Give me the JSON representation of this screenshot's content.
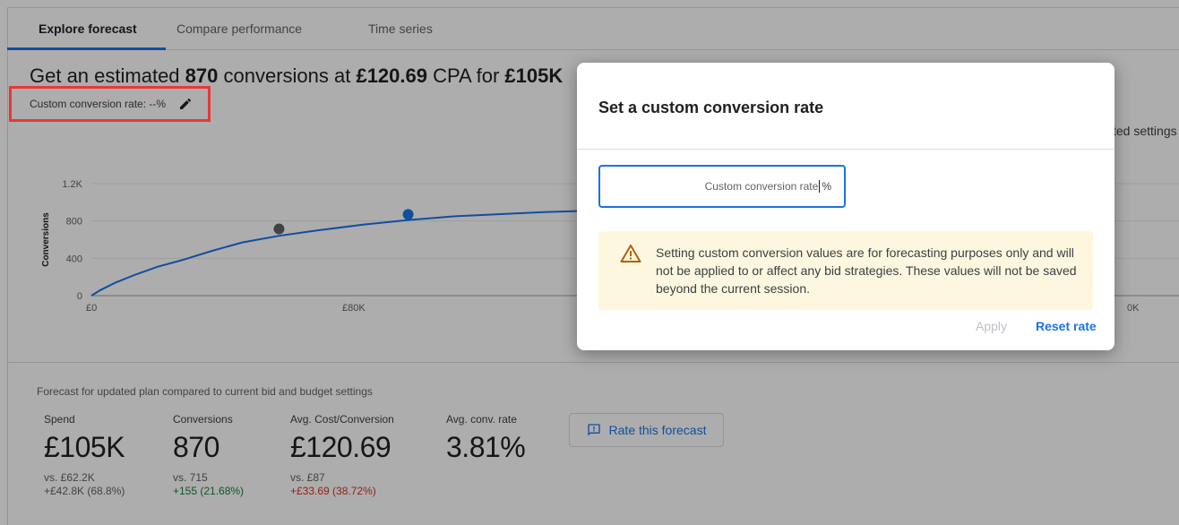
{
  "tabs": [
    {
      "label": "Explore forecast",
      "active": true
    },
    {
      "label": "Compare performance",
      "active": false
    },
    {
      "label": "Time series",
      "active": false
    }
  ],
  "headline": {
    "prefix": "Get an estimated ",
    "conversions": "870",
    "middle1": " conversions at ",
    "cpa": "£120.69",
    "middle2": " CPA for ",
    "budget": "£105K"
  },
  "custom_rate_label": "Custom conversion rate: --%",
  "right_fragment": "ted settings",
  "chart": {
    "ylabel": "Conversions",
    "y_ticks": [
      "1.2K",
      "800",
      "400",
      "0"
    ],
    "x_ticks": [
      "£0",
      "£80K",
      "0K"
    ]
  },
  "chart_data": {
    "type": "line",
    "ylabel": "Conversions",
    "xlabel": "",
    "ylim": [
      0,
      1200
    ],
    "y_tick_values": [
      0,
      400,
      800,
      1200
    ],
    "series": [
      {
        "x": [
          0,
          3,
          8,
          15,
          22,
          30,
          40,
          50,
          62,
          75,
          90,
          105,
          120,
          150,
          185,
          250,
          330
        ],
        "values": [
          0,
          60,
          140,
          230,
          310,
          380,
          480,
          570,
          640,
          700,
          760,
          810,
          850,
          895,
          930,
          1000,
          1070
        ]
      }
    ],
    "markers": [
      {
        "x": 62.2,
        "y": 715,
        "label": "current",
        "color": "#5f6368"
      },
      {
        "x": 105,
        "y": 870,
        "label": "forecast",
        "color": "#1a73e8"
      }
    ]
  },
  "forecast_note": "Forecast for updated plan compared to current bid and budget settings",
  "metrics": [
    {
      "label": "Spend",
      "value": "£105K",
      "vs": "vs. £62.2K",
      "delta": "+£42.8K (68.8%)",
      "delta_color": "#5f6368"
    },
    {
      "label": "Conversions",
      "value": "870",
      "vs": "vs. 715",
      "delta": "+155 (21.68%)",
      "delta_color": "#188038"
    },
    {
      "label": "Avg. Cost/Conversion",
      "value": "£120.69",
      "vs": "vs. £87",
      "delta": "+£33.69 (38.72%)",
      "delta_color": "#d93025"
    },
    {
      "label": "Avg. conv. rate",
      "value": "3.81%",
      "vs": "",
      "delta": "",
      "delta_color": "#5f6368"
    }
  ],
  "rate_forecast_label": "Rate this forecast",
  "dialog": {
    "title": "Set a custom conversion rate",
    "input_placeholder": "Custom conversion rate",
    "input_suffix": "%",
    "warning": "Setting custom conversion values are for forecasting purposes only and will not be applied to or affect any bid strategies. These values will not be saved beyond the current session.",
    "apply_label": "Apply",
    "reset_label": "Reset rate"
  },
  "colors": {
    "accent": "#1a73e8",
    "warning_bg": "#fef7e0",
    "warning_icon": "#b06000",
    "highlight": "#e53935"
  }
}
